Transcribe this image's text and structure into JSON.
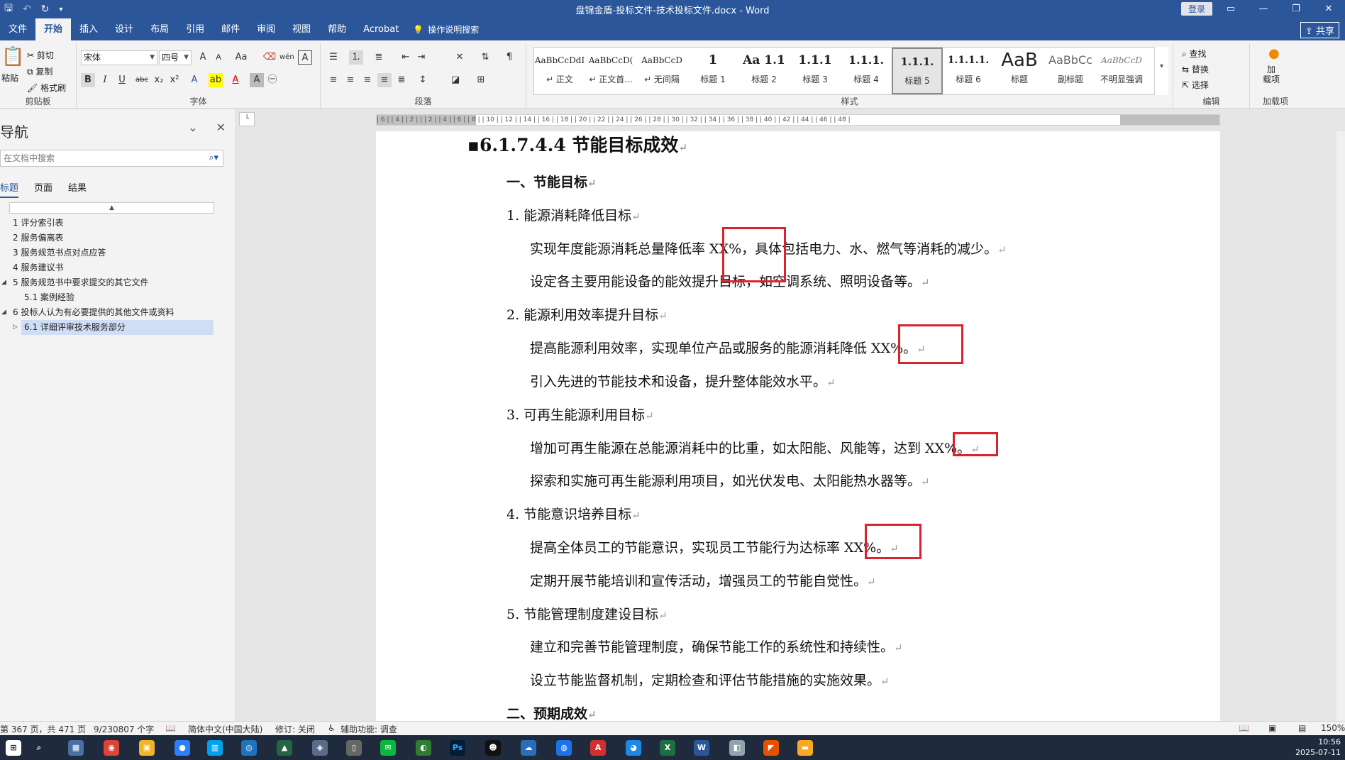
{
  "titlebar": {
    "doc_title": "盘锦金盾-投标文件-技术投标文件.docx - Word",
    "login": "登录",
    "qat_save": "🖫",
    "qat_undo": "↶",
    "qat_redo": "↻",
    "qat_more": "▾"
  },
  "tabs": [
    "文件",
    "开始",
    "插入",
    "设计",
    "布局",
    "引用",
    "邮件",
    "审阅",
    "视图",
    "帮助",
    "Acrobat"
  ],
  "tell_me": "操作说明搜索",
  "share": "共享",
  "clipboard": {
    "paste": "粘贴",
    "cut": "剪切",
    "copy": "复制",
    "format_painter": "格式刷",
    "label": "剪贴板"
  },
  "font": {
    "name": "宋体",
    "size": "四号",
    "label": "字体"
  },
  "paragraph_label": "段落",
  "styles": {
    "label": "样式",
    "items": [
      {
        "preview": "AaBbCcDdI",
        "name": "↵ 正文"
      },
      {
        "preview": "AaBbCcD(",
        "name": "↵ 正文首..."
      },
      {
        "preview": "AaBbCcD",
        "name": "↵ 无间隔"
      },
      {
        "preview": "1",
        "name": "标题 1"
      },
      {
        "preview": "Aa 1.1",
        "name": "标题 2"
      },
      {
        "preview": "1.1.1",
        "name": "标题 3"
      },
      {
        "preview": "1.1.1.",
        "name": "标题 4"
      },
      {
        "preview": "1.1.1.",
        "name": "标题 5"
      },
      {
        "preview": "1.1.1.1.",
        "name": "标题 6"
      },
      {
        "preview": "AaB",
        "name": "标题"
      },
      {
        "preview": "AaBbCc",
        "name": "副标题"
      },
      {
        "preview": "AaBbCcD",
        "name": "不明显强调"
      }
    ],
    "selected_index": 7
  },
  "editing": {
    "find": "查找",
    "replace": "替换",
    "select": "选择",
    "label": "编辑"
  },
  "addins": {
    "add": "加\n载项",
    "label": "加载项"
  },
  "nav": {
    "title": "导航",
    "search_placeholder": "在文档中搜索",
    "tabs": [
      "标题",
      "页面",
      "结果"
    ],
    "headings": [
      {
        "text": "1 评分索引表",
        "level": 1
      },
      {
        "text": "2 服务偏离表",
        "level": 1
      },
      {
        "text": "3 服务规范书点对点应答",
        "level": 1
      },
      {
        "text": "4 服务建议书",
        "level": 1
      },
      {
        "text": "5 服务规范书中要求提交的其它文件",
        "level": 1,
        "expanded": true
      },
      {
        "text": "5.1 案例经验",
        "level": 2
      },
      {
        "text": "6 投标人认为有必要提供的其他文件或资料",
        "level": 1,
        "expanded": true
      },
      {
        "text": "6.1 详细评审技术服务部分",
        "level": 2,
        "selected": true,
        "collapsed": true
      }
    ]
  },
  "ruler_text": "| 6 |  | 4 |  | 2 |  |  | 2 |  | 4 |  | 6 |  | 8 |  | 10 |  | 12 |  | 14 |  | 16 |  | 18 |  | 20 |  | 22 |  | 24 |  | 26 |  | 28 |  | 30 |  | 32 |  | 34 |  | 36 |  | 38 |  | 40 |  | 42 |  | 44 |  | 46 |  | 48 |",
  "document": {
    "heading": "▪6.1.7.4.4    节能目标成效",
    "section1": "一、节能目标",
    "items": [
      {
        "title": "1.  能源消耗降低目标",
        "paras": [
          "实现年度能源消耗总量降低率 XX%，具体包括电力、水、燃气等消耗的减少。",
          "设定各主要用能设备的能效提升目标，如空调系统、照明设备等。"
        ]
      },
      {
        "title": "2.  能源利用效率提升目标",
        "paras": [
          "提高能源利用效率，实现单位产品或服务的能源消耗降低 XX%。",
          "引入先进的节能技术和设备，提升整体能效水平。"
        ]
      },
      {
        "title": "3.  可再生能源利用目标",
        "paras": [
          "增加可再生能源在总能源消耗中的比重，如太阳能、风能等，达到 XX%。",
          "探索和实施可再生能源利用项目，如光伏发电、太阳能热水器等。"
        ]
      },
      {
        "title": "4.  节能意识培养目标",
        "paras": [
          "提高全体员工的节能意识，实现员工节能行为达标率 XX%。",
          "定期开展节能培训和宣传活动，增强员工的节能自觉性。"
        ]
      },
      {
        "title": "5.  节能管理制度建设目标",
        "paras": [
          "建立和完善节能管理制度，确保节能工作的系统性和持续性。",
          "设立节能监督机制，定期检查和评估节能措施的实施效果。"
        ]
      }
    ],
    "section2": "二、预期成效",
    "para_mark": "↵"
  },
  "status": {
    "page": "第 367 页，共 471 页",
    "words": "9/230807 个字",
    "lang": "简体中文(中国大陆)",
    "track": "修订: 关闭",
    "access": "辅助功能: 调查",
    "zoom": "150%"
  },
  "clock": {
    "time": "10:56",
    "date": "2025-07-11"
  },
  "colors": {
    "accent": "#2b579a",
    "highlight_box": "#d9232e",
    "nav_selected": "#cfdef5"
  }
}
